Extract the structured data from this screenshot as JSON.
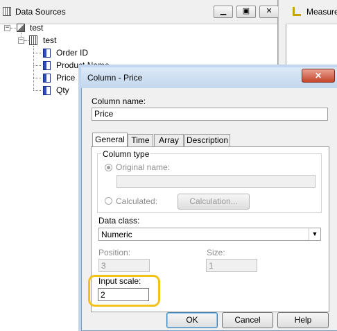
{
  "data_sources_pane": {
    "title": "Data Sources",
    "window_buttons": {
      "minimize": "▁",
      "restore": "▣",
      "close": "✕"
    },
    "tree": {
      "root": {
        "label": "test",
        "expander": "−"
      },
      "table": {
        "label": "test",
        "expander": "−"
      },
      "columns": [
        {
          "label": "Order ID"
        },
        {
          "label": "Product Name"
        },
        {
          "label": "Price"
        },
        {
          "label": "Qty"
        }
      ]
    }
  },
  "measures_pane": {
    "title": "Measure"
  },
  "dialog": {
    "title": "Column - Price",
    "close_glyph": "✕",
    "column_name_label": "Column name:",
    "column_name_value": "Price",
    "tabs": [
      {
        "label": "General",
        "active": true
      },
      {
        "label": "Time"
      },
      {
        "label": "Array"
      },
      {
        "label": "Description"
      }
    ],
    "column_type": {
      "legend": "Column type",
      "original_name_label": "Original name:",
      "original_name_value": "",
      "calculated_label": "Calculated:",
      "calculation_button": "Calculation..."
    },
    "data_class": {
      "label": "Data class:",
      "value": "Numeric"
    },
    "position": {
      "label": "Position:",
      "value": "3"
    },
    "size": {
      "label": "Size:",
      "value": "1"
    },
    "input_scale": {
      "label": "Input scale:",
      "value": "2"
    },
    "buttons": {
      "ok": "OK",
      "cancel": "Cancel",
      "help": "Help"
    },
    "highlight_color": "#f2c21a"
  }
}
